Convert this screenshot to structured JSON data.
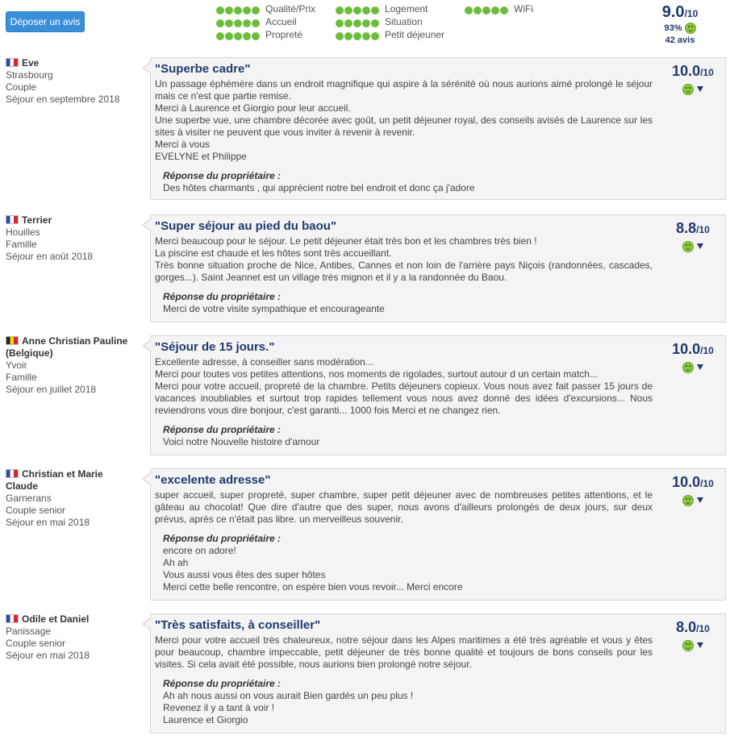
{
  "header": {
    "post_review_label": "Déposer un avis",
    "criteria": [
      {
        "label": "Qualité/Prix",
        "dots": 5
      },
      {
        "label": "Accueil",
        "dots": 5
      },
      {
        "label": "Propreté",
        "dots": 5
      },
      {
        "label": "Logement",
        "dots": 5
      },
      {
        "label": "Situation",
        "dots": 5
      },
      {
        "label": "Petit déjeuner",
        "dots": 5
      },
      {
        "label": "WiFi",
        "dots": 5
      }
    ],
    "global": {
      "score": "9.0",
      "out_of": "/10",
      "percent": "93%",
      "count": "42 avis"
    }
  },
  "colors": {
    "accent": "#1f3a6e",
    "button": "#3b8fd9",
    "dot": "#6dbd3c"
  },
  "reviews": [
    {
      "author": "Eve",
      "flag": "fr",
      "city": "Strasbourg",
      "type": "Couple",
      "stay": "Séjour en septembre 2018",
      "title": "\"Superbe cadre\"",
      "body": [
        "Un passage éphémère dans un endroit magnifique qui aspire à la sérénité où nous aurions aimé prolongé le séjour mais ce n'est que partie remise.",
        "Merci à Laurence et Giorgio pour leur accueil.",
        "Une superbe vue, une chambre décorée avec goût, un petit déjeuner royal, des conseils avisés de Laurence sur les sites à visiter ne peuvent que vous inviter à revenir à revenir.",
        "Merci à vous",
        "EVELYNE et Philippe"
      ],
      "response_label": "Réponse du propriétaire :",
      "response": [
        "Des hôtes charmants , qui apprécient notre bel endroit et donc ça j'adore"
      ],
      "score": "10.0",
      "out_of": "/10"
    },
    {
      "author": "Terrier",
      "flag": "fr",
      "city": "Houilles",
      "type": "Famille",
      "stay": "Séjour en août 2018",
      "title": "\"Super séjour au pied du baou\"",
      "body": [
        "Merci beaucoup pour le séjour. Le petit déjeuner était très bon et les chambres très bien !",
        "La piscine est chaude et les hôtes sont très accueillant.",
        "Très bonne situation proche de Nice, Antibes, Cannes et non loin de l'arrière pays Niçois (randonnées, cascades, gorges...). Saint Jeannet est un village très mignon et il y a la randonnée du Baou."
      ],
      "response_label": "Réponse du propriétaire :",
      "response": [
        "Merci de votre visite sympathique et encourageante"
      ],
      "score": "8.8",
      "out_of": "/10"
    },
    {
      "author": "Anne Christian Pauline (Belgique)",
      "flag": "be",
      "city": "Yvoir",
      "type": "Famille",
      "stay": "Séjour en juillet 2018",
      "title": "\"Séjour de 15 jours.\"",
      "body": [
        "Excellente adresse, à conseiller sans modération...",
        "Merci pour toutes vos petites attentions, nos moments de rigolades, surtout autour d un certain match...",
        "Merci pour votre accueil, propreté de la chambre. Petits déjeuners copieux. Vous nous avez fait passer 15 jours de vacances inoubliables et surtout trop rapides tellement vous nous avez donné des idées d'excursions... Nous reviendrons vous dire bonjour, c'est garanti... 1000 fois Merci et ne changez rien."
      ],
      "response_label": "Réponse du propriétaire :",
      "response": [
        "Voici notre Nouvelle histoire d'amour"
      ],
      "score": "10.0",
      "out_of": "/10"
    },
    {
      "author": "Christian et Marie Claude",
      "flag": "fr",
      "city": "Garnerans",
      "type": "Couple senior",
      "stay": "Séjour en mai 2018",
      "title": "\"excelente adresse\"",
      "body": [
        "super accueil, super propreté, super chambre, super petit déjeuner avec de nombreuses petites attentions, et le gâteau au chocolat! Que dire d'autre que des super, nous avons d'ailleurs prolongés de deux jours, sur deux prévus, après ce n'était pas libre. un merveilleus souvenir."
      ],
      "response_label": "Réponse du propriétaire :",
      "response": [
        "encore on adore!",
        "Ah ah",
        "Vous aussi vous êtes des super hôtes",
        "Merci cette belle rencontre, on espère bien vous revoir... Merci encore"
      ],
      "score": "10.0",
      "out_of": "/10"
    },
    {
      "author": "Odile et Daniel",
      "flag": "fr",
      "city": "Panissage",
      "type": "Couple senior",
      "stay": "Séjour en mai 2018",
      "title": "\"Très satisfaits, à conseiller\"",
      "body": [
        "Merci pour votre accueil très chaleureux, notre séjour dans les Alpes maritimes a été très agréable et vous y êtes pour beaucoup, chambre impeccable, petit déjeuner de très bonne qualité et toujours de bons conseils pour les visites. Si cela avait été possible, nous aurions bien prolongé notre séjour."
      ],
      "response_label": "Réponse du propriétaire :",
      "response": [
        "Ah ah nous aussi on vous aurait Bien gardés un peu plus !",
        "Revenez il y a tant à voir !",
        "Laurence et Giorgio"
      ],
      "score": "8.0",
      "out_of": "/10"
    }
  ]
}
